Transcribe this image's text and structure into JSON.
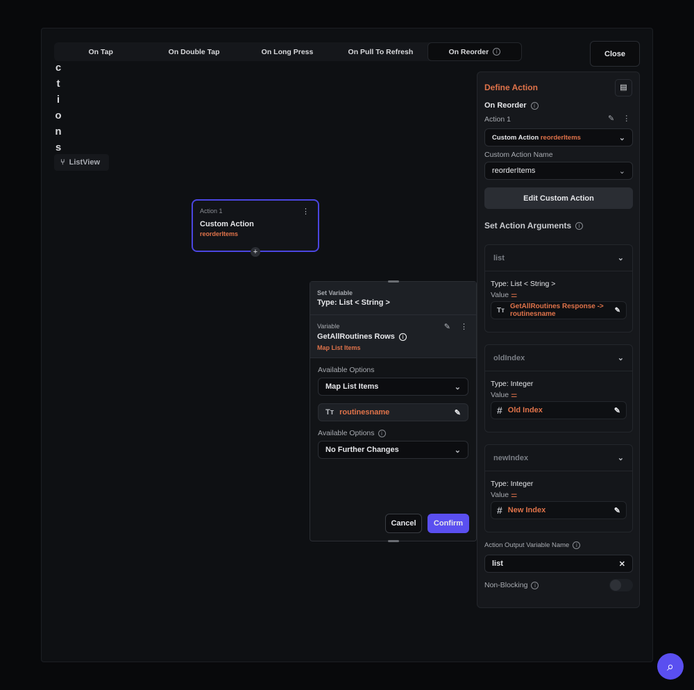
{
  "tabs": [
    "On Tap",
    "On Double Tap",
    "On Long Press",
    "On Pull To Refresh",
    "On Reorder"
  ],
  "close_label": "Close",
  "vertical_label": [
    "c",
    "t",
    "i",
    "o",
    "n",
    "s"
  ],
  "chip_label": "ListView",
  "node": {
    "title": "Action 1",
    "name": "Custom Action",
    "sub": "reorderItems"
  },
  "set_variable": {
    "title": "Set Variable",
    "type": "Type: List < String >",
    "var_label": "Variable",
    "var_name": "GetAllRoutines Rows",
    "var_sub": "Map List Items",
    "opt_label1": "Available Options",
    "opt_value1": "Map List Items",
    "field_value": "routinesname",
    "opt_label2": "Available Options",
    "opt_value2": "No Further Changes",
    "cancel": "Cancel",
    "confirm": "Confirm"
  },
  "panel": {
    "title": "Define Action",
    "trigger": "On Reorder",
    "action_label": "Action 1",
    "action_type": "Custom Action",
    "action_name": "reorderItems",
    "name_label": "Custom Action Name",
    "name_value": "reorderItems",
    "edit_button": "Edit Custom Action",
    "args_title": "Set Action Arguments",
    "args": [
      {
        "name": "list",
        "type": "Type: List < String >",
        "value_label": "Value",
        "value": "GetAllRoutines Response -> routinesname",
        "icon": "Tт"
      },
      {
        "name": "oldIndex",
        "type": "Type: Integer",
        "value_label": "Value",
        "value": "Old Index",
        "icon": "#"
      },
      {
        "name": "newIndex",
        "type": "Type: Integer",
        "value_label": "Value",
        "value": "New Index",
        "icon": "#"
      }
    ],
    "output_label": "Action Output Variable Name",
    "output_value": "list",
    "nonblocking_label": "Non-Blocking"
  },
  "colors": {
    "accent": "#e0734a",
    "primary": "#5a4ff0"
  }
}
